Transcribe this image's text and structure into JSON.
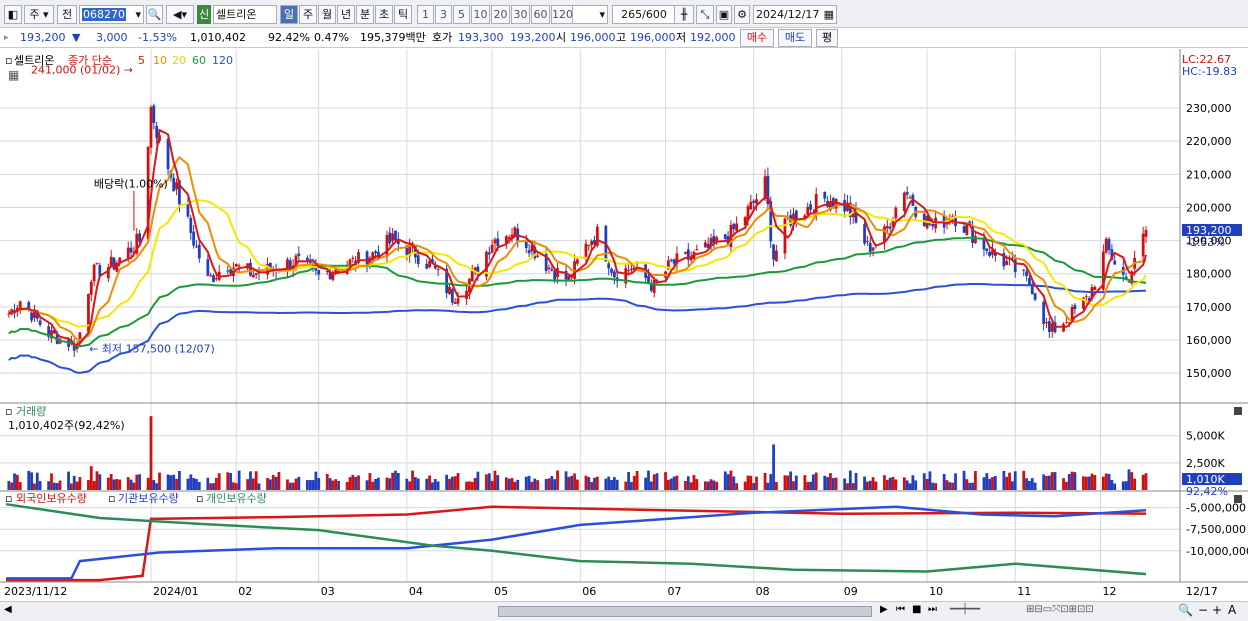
{
  "toolbar": {
    "period_type": "주",
    "prev_label": "전",
    "stock_code": "068270",
    "new_badge": "신",
    "stock_name": "셀트리온",
    "periods": [
      "일",
      "주",
      "월",
      "년",
      "분",
      "초",
      "틱"
    ],
    "selected_period": "일",
    "intervals": [
      "1",
      "3",
      "5",
      "10",
      "20",
      "30",
      "60",
      "120"
    ],
    "count_value": "265",
    "count_total": "/600",
    "date_value": "2024/12/17"
  },
  "quote": {
    "price": "193,200",
    "change": "3,000",
    "change_pct": "-1.53%",
    "volume": "1,010,402",
    "vol_ratio": "92.42%",
    "turnover": "0.47%",
    "amount": "195,379백만",
    "bid_label": "호가",
    "bid1": "193,300",
    "bid2": "193,200",
    "open_label": "시",
    "open": "196,000",
    "high_label": "고",
    "high": "196,000",
    "low_label": "저",
    "low": "192,000",
    "buy_label": "매수",
    "sell_label": "매도",
    "avg_label": "평"
  },
  "colors": {
    "up": "#d01010",
    "down": "#1f3fbf",
    "ma5": "#d81818",
    "ma10": "#f08c00",
    "ma20": "#f5e800",
    "ma60": "#1b9a3a",
    "ma120": "#2c4fd8",
    "foreign": "#d81818",
    "institution": "#2c4fd8",
    "individual": "#2e8b57"
  },
  "chart_data": [
    {
      "type": "candlestick",
      "title": "셀트리온",
      "legend": [
        "종가 단순",
        "5",
        "10",
        "20",
        "60",
        "120"
      ],
      "lc_label": "LC:22.67",
      "hc_label": "HC:-19.83",
      "ylim": [
        141000,
        246000
      ],
      "yticks": [
        "230,000",
        "220,000",
        "210,000",
        "200,000",
        "190,000",
        "180,000",
        "170,000",
        "160,000",
        "150,000"
      ],
      "ytick_values": [
        230000,
        220000,
        210000,
        200000,
        190000,
        180000,
        170000,
        160000,
        150000
      ],
      "current_price_label": "193,200",
      "current_change_label": "-1.53%",
      "annotations": [
        {
          "text": "241,000 (01/02)",
          "value": 241000,
          "date": "2024-01-02"
        },
        {
          "text": "배당락(1.00%)",
          "date": "2023-12-27"
        },
        {
          "text": "최저 157,500 (12/07)",
          "value": 157500,
          "date": "2023-12-07"
        }
      ],
      "keypoints": [
        {
          "date": "2023-11-12",
          "price": 167000
        },
        {
          "date": "2023-11-17",
          "price": 172000
        },
        {
          "date": "2023-11-27",
          "price": 162000
        },
        {
          "date": "2023-12-07",
          "price": 158000
        },
        {
          "date": "2023-12-12",
          "price": 180000
        },
        {
          "date": "2023-12-20",
          "price": 183000
        },
        {
          "date": "2023-12-29",
          "price": 190000
        },
        {
          "date": "2024-01-02",
          "price": 230000
        },
        {
          "date": "2024-01-05",
          "price": 220000
        },
        {
          "date": "2024-01-11",
          "price": 205000
        },
        {
          "date": "2024-01-17",
          "price": 190000
        },
        {
          "date": "2024-01-22",
          "price": 178000
        },
        {
          "date": "2024-01-29",
          "price": 183000
        },
        {
          "date": "2024-02-07",
          "price": 180000
        },
        {
          "date": "2024-02-16",
          "price": 182000
        },
        {
          "date": "2024-02-22",
          "price": 184000
        },
        {
          "date": "2024-03-01",
          "price": 179000
        },
        {
          "date": "2024-03-07",
          "price": 182000
        },
        {
          "date": "2024-03-15",
          "price": 184000
        },
        {
          "date": "2024-03-20",
          "price": 186000
        },
        {
          "date": "2024-03-27",
          "price": 190000
        },
        {
          "date": "2024-04-03",
          "price": 187000
        },
        {
          "date": "2024-04-10",
          "price": 182000
        },
        {
          "date": "2024-04-17",
          "price": 173000
        },
        {
          "date": "2024-04-25",
          "price": 180000
        },
        {
          "date": "2024-05-01",
          "price": 190000
        },
        {
          "date": "2024-05-08",
          "price": 193000
        },
        {
          "date": "2024-05-14",
          "price": 189000
        },
        {
          "date": "2024-05-21",
          "price": 182000
        },
        {
          "date": "2024-05-28",
          "price": 178000
        },
        {
          "date": "2024-06-04",
          "price": 190000
        },
        {
          "date": "2024-06-07",
          "price": 192000
        },
        {
          "date": "2024-06-13",
          "price": 180000
        },
        {
          "date": "2024-06-20",
          "price": 182000
        },
        {
          "date": "2024-06-27",
          "price": 176000
        },
        {
          "date": "2024-07-03",
          "price": 183000
        },
        {
          "date": "2024-07-10",
          "price": 185000
        },
        {
          "date": "2024-07-17",
          "price": 188000
        },
        {
          "date": "2024-07-24",
          "price": 192000
        },
        {
          "date": "2024-07-31",
          "price": 200000
        },
        {
          "date": "2024-08-05",
          "price": 207000
        },
        {
          "date": "2024-08-08",
          "price": 185000
        },
        {
          "date": "2024-08-13",
          "price": 196000
        },
        {
          "date": "2024-08-20",
          "price": 200000
        },
        {
          "date": "2024-08-27",
          "price": 203000
        },
        {
          "date": "2024-09-03",
          "price": 200000
        },
        {
          "date": "2024-09-10",
          "price": 188000
        },
        {
          "date": "2024-09-15",
          "price": 190000
        },
        {
          "date": "2024-09-23",
          "price": 206000
        },
        {
          "date": "2024-09-27",
          "price": 200000
        },
        {
          "date": "2024-10-03",
          "price": 194000
        },
        {
          "date": "2024-10-10",
          "price": 198000
        },
        {
          "date": "2024-10-17",
          "price": 192000
        },
        {
          "date": "2024-10-24",
          "price": 186000
        },
        {
          "date": "2024-10-31",
          "price": 182000
        },
        {
          "date": "2024-11-07",
          "price": 176000
        },
        {
          "date": "2024-11-13",
          "price": 162000
        },
        {
          "date": "2024-11-20",
          "price": 167000
        },
        {
          "date": "2024-11-27",
          "price": 173000
        },
        {
          "date": "2024-12-03",
          "price": 188000
        },
        {
          "date": "2024-12-10",
          "price": 178000
        },
        {
          "date": "2024-12-13",
          "price": 183000
        },
        {
          "date": "2024-12-17",
          "price": 193200
        }
      ]
    },
    {
      "type": "bar",
      "title": "거래량",
      "current_label": "1,010,402주(92,42%)",
      "yticks": [
        "5,000K",
        "2,500K"
      ],
      "ytick_values": [
        5000000,
        2500000
      ],
      "ylim": [
        0,
        7000000
      ],
      "current_value_label": "1,010K",
      "current_pct_label": "92,42%",
      "spikes": [
        {
          "date": "2024-01-02",
          "value": 6800000
        },
        {
          "date": "2023-12-12",
          "value": 2200000
        },
        {
          "date": "2024-08-08",
          "value": 4200000
        },
        {
          "date": "2024-12-11",
          "value": 1900000
        }
      ]
    },
    {
      "type": "line",
      "legend": [
        "외국인보유수량",
        "기관보유수량",
        "개인보유수량"
      ],
      "yticks": [
        "-5,000,000",
        "-7,500,000",
        "-10,000,000"
      ],
      "ytick_values": [
        -5000000,
        -7500000,
        -10000000
      ],
      "ylim": [
        -13500000,
        -4000000
      ],
      "series": [
        {
          "name": "외국인보유수량",
          "points": [
            {
              "date": "2023-11-12",
              "value": -13400000
            },
            {
              "date": "2023-12-15",
              "value": -13400000
            },
            {
              "date": "2023-12-30",
              "value": -12900000
            },
            {
              "date": "2024-01-02",
              "value": -6300000
            },
            {
              "date": "2024-02-15",
              "value": -6100000
            },
            {
              "date": "2024-04-01",
              "value": -5800000
            },
            {
              "date": "2024-05-01",
              "value": -4900000
            },
            {
              "date": "2024-07-01",
              "value": -5300000
            },
            {
              "date": "2024-09-01",
              "value": -5700000
            },
            {
              "date": "2024-11-01",
              "value": -5600000
            },
            {
              "date": "2024-12-17",
              "value": -5700000
            }
          ]
        },
        {
          "name": "기관보유수량",
          "points": [
            {
              "date": "2023-11-12",
              "value": -13200000
            },
            {
              "date": "2023-12-05",
              "value": -13200000
            },
            {
              "date": "2023-12-08",
              "value": -11200000
            },
            {
              "date": "2024-01-05",
              "value": -10200000
            },
            {
              "date": "2024-02-15",
              "value": -9700000
            },
            {
              "date": "2024-04-01",
              "value": -9700000
            },
            {
              "date": "2024-05-01",
              "value": -8700000
            },
            {
              "date": "2024-06-01",
              "value": -7000000
            },
            {
              "date": "2024-08-01",
              "value": -5600000
            },
            {
              "date": "2024-09-20",
              "value": -4900000
            },
            {
              "date": "2024-10-20",
              "value": -5800000
            },
            {
              "date": "2024-11-15",
              "value": -6000000
            },
            {
              "date": "2024-12-17",
              "value": -5300000
            }
          ]
        },
        {
          "name": "개인보유수량",
          "points": [
            {
              "date": "2023-11-12",
              "value": -4600000
            },
            {
              "date": "2023-12-15",
              "value": -6200000
            },
            {
              "date": "2024-01-20",
              "value": -6900000
            },
            {
              "date": "2024-03-01",
              "value": -7600000
            },
            {
              "date": "2024-04-10",
              "value": -9400000
            },
            {
              "date": "2024-05-01",
              "value": -10000000
            },
            {
              "date": "2024-06-01",
              "value": -11200000
            },
            {
              "date": "2024-07-10",
              "value": -11500000
            },
            {
              "date": "2024-08-15",
              "value": -12200000
            },
            {
              "date": "2024-10-01",
              "value": -12400000
            },
            {
              "date": "2024-11-01",
              "value": -11500000
            },
            {
              "date": "2024-12-17",
              "value": -12700000
            }
          ]
        }
      ]
    }
  ],
  "x_axis": {
    "start_label": "2023/11/12",
    "labels": [
      "2024/01",
      "02",
      "03",
      "04",
      "05",
      "06",
      "07",
      "08",
      "09",
      "10",
      "11",
      "12"
    ],
    "label_dates": [
      "2024-01-02",
      "2024-02-01",
      "2024-03-01",
      "2024-04-01",
      "2024-05-01",
      "2024-06-01",
      "2024-07-01",
      "2024-08-01",
      "2024-09-01",
      "2024-10-01",
      "2024-11-01",
      "2024-12-01"
    ],
    "right_label": "12/17"
  }
}
